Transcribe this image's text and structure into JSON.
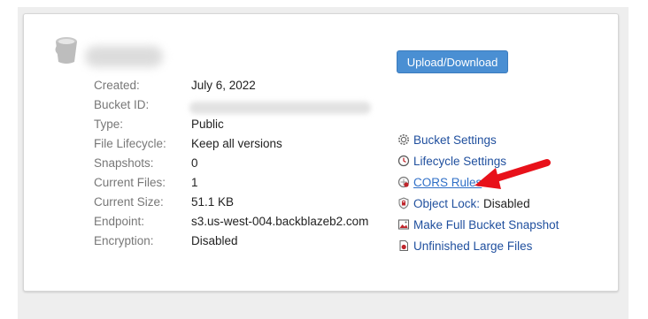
{
  "bucket": {
    "icon": "bucket-icon",
    "name_redacted": true,
    "upload_button_label": "Upload/Download"
  },
  "info": {
    "created_label": "Created:",
    "created_value": "July 6, 2022",
    "bucket_id_label": "Bucket ID:",
    "type_label": "Type:",
    "type_value": "Public",
    "lifecycle_label": "File Lifecycle:",
    "lifecycle_value": "Keep all versions",
    "snapshots_label": "Snapshots:",
    "snapshots_value": "0",
    "files_label": "Current Files:",
    "files_value": "1",
    "size_label": "Current Size:",
    "size_value": "51.1 KB",
    "endpoint_label": "Endpoint:",
    "endpoint_value": "s3.us-west-004.backblazeb2.com",
    "encryption_label": "Encryption:",
    "encryption_value": "Disabled"
  },
  "links": {
    "bucket_settings": {
      "label": "Bucket Settings",
      "icon": "gear-icon"
    },
    "lifecycle_settings": {
      "label": "Lifecycle Settings",
      "icon": "clock-icon"
    },
    "cors_rules": {
      "label": "CORS Rules",
      "icon": "cors-icon"
    },
    "object_lock": {
      "label": "Object Lock:",
      "status": "Disabled",
      "icon": "shield-lock-icon"
    },
    "snapshot": {
      "label": "Make Full Bucket Snapshot",
      "icon": "image-icon"
    },
    "unfinished": {
      "label": "Unfinished Large Files",
      "icon": "file-icon"
    }
  },
  "colors": {
    "accent": "#4a8fd3",
    "link": "#1f4f9e",
    "annotation_arrow": "#e8111a"
  }
}
